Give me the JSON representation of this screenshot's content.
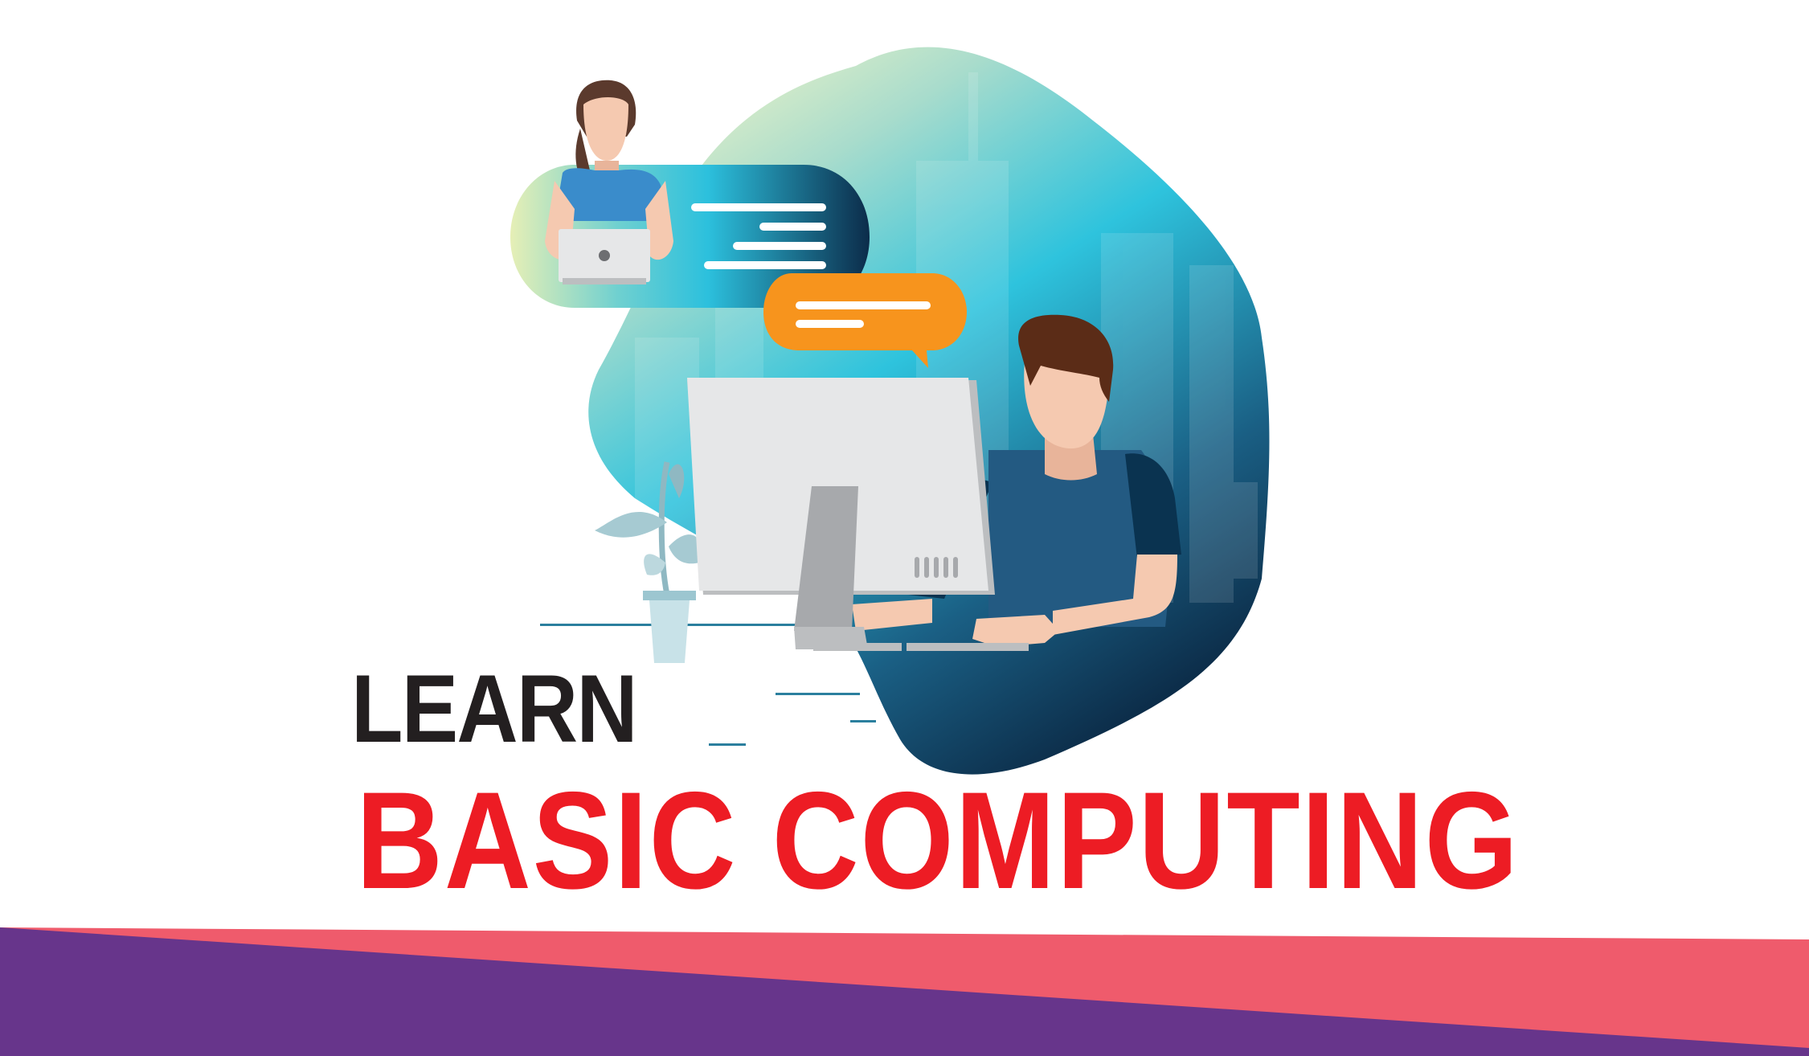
{
  "headline": {
    "learn": "LEARN",
    "main": "BASIC COMPUTING"
  },
  "colors": {
    "learn_text": "#231f20",
    "main_text": "#ed1c24",
    "footer_purple": "#67358b",
    "footer_coral": "#ef5b6c",
    "chat_bubble_left": "#2fc0dd",
    "chat_bubble_right": "#f7941d",
    "blob_top": "#eef4c4",
    "blob_mid": "#2ec3dd",
    "blob_bottom": "#0a2540"
  },
  "illustration": {
    "blob": "background-blob",
    "woman": "woman-with-laptop",
    "man": "man-at-computer",
    "monitor": "desktop-monitor",
    "plant": "potted-plant",
    "bubble_left": "chat-bubble-icon",
    "bubble_right": "chat-bubble-icon"
  }
}
